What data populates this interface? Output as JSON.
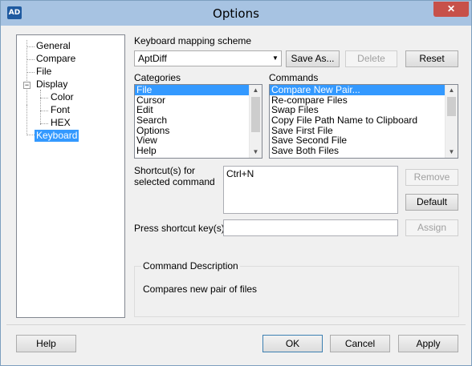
{
  "window": {
    "title": "Options",
    "icon_text": "AD",
    "close_symbol": "✕"
  },
  "tree": {
    "items": [
      {
        "label": "General"
      },
      {
        "label": "Compare"
      },
      {
        "label": "File"
      },
      {
        "label": "Display",
        "expander": "−"
      },
      {
        "label": "Color"
      },
      {
        "label": "Font"
      },
      {
        "label": "HEX"
      },
      {
        "label": "Keyboard",
        "selected": true
      }
    ]
  },
  "keyboard": {
    "scheme_label": "Keyboard mapping scheme",
    "scheme_value": "AptDiff",
    "save_as_label": "Save As...",
    "delete_label": "Delete",
    "reset_label": "Reset",
    "categories_label": "Categories",
    "categories": [
      "File",
      "Cursor",
      "Edit",
      "Search",
      "Options",
      "View",
      "Help"
    ],
    "commands_label": "Commands",
    "commands": [
      "Compare New Pair...",
      "Re-compare Files",
      "Swap Files",
      "Copy File Path Name to Clipboard",
      "Save First File",
      "Save Second File",
      "Save Both Files"
    ],
    "shortcuts_label_line1": "Shortcut(s) for",
    "shortcuts_label_line2": "selected command",
    "shortcuts_value": "Ctrl+N",
    "remove_label": "Remove",
    "default_label": "Default",
    "press_label": "Press shortcut key(s)",
    "press_value": "",
    "assign_label": "Assign",
    "description_caption": "Command Description",
    "description_text": "Compares new pair of files"
  },
  "footer": {
    "help_label": "Help",
    "ok_label": "OK",
    "cancel_label": "Cancel",
    "apply_label": "Apply"
  },
  "icons": {
    "dropdown": "chevron-down-icon",
    "scroll_up": "chevron-up-icon",
    "scroll_down": "chevron-down-icon"
  },
  "colors": {
    "selection": "#3399ff",
    "titlebar": "#a7c3e2",
    "close": "#c7514a"
  }
}
